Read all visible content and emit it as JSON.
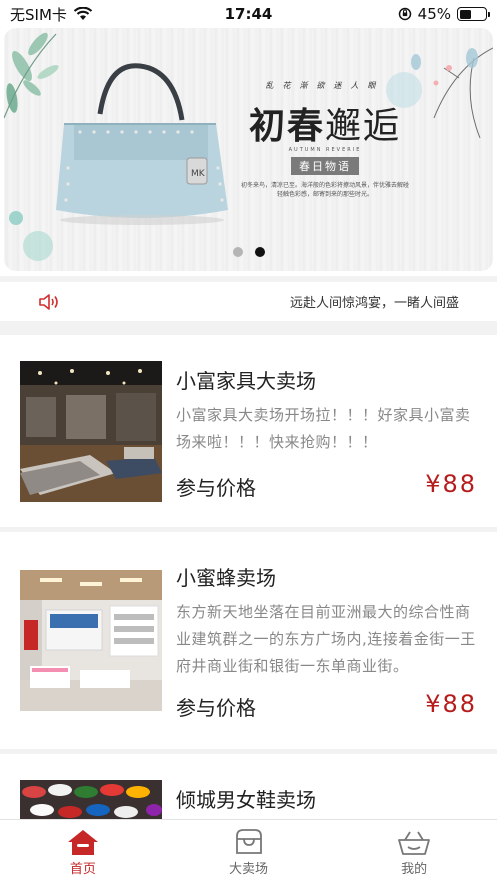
{
  "status": {
    "carrier": "无SIM卡",
    "time": "17:44",
    "battery": "45%",
    "battery_level": 0.45
  },
  "banner": {
    "top_line": "乱花渐欲迷人眼",
    "title_bold": "初春",
    "title_light": "邂逅",
    "subtitle": "AUTUMN REVERIE",
    "tag": "春日物语",
    "desc": "初冬来鸟，清凉已至。海洋般的色彩将撩动风景，伴优雅去解碰轻触色彩感，邮寄到来的那些时光。",
    "slides": 2,
    "active_slide": 1
  },
  "notice": {
    "icon": "speaker-icon",
    "text": "远赴人间惊鸿宴，一睹人间盛"
  },
  "cards": [
    {
      "title": "小富家具大卖场",
      "desc": "小富家具大卖场开场拉！！！好家具小富卖场来啦！！！快来抢购！！！",
      "price_label": "参与价格",
      "price": "¥88"
    },
    {
      "title": "小蜜蜂卖场",
      "desc": "东方新天地坐落在目前亚洲最大的综合性商业建筑群之一的东方广场内,连接着金街一王府井商业街和银街一东单商业街。",
      "price_label": "参与价格",
      "price": "¥88"
    },
    {
      "title": "倾城男女鞋卖场"
    }
  ],
  "tabbar": {
    "items": [
      {
        "label": "首页",
        "icon": "home-icon",
        "active": true
      },
      {
        "label": "大卖场",
        "icon": "store-icon",
        "active": false
      },
      {
        "label": "我的",
        "icon": "basket-icon",
        "active": false
      }
    ],
    "active_color": "#c62828",
    "price_color": "#b71c1c"
  }
}
